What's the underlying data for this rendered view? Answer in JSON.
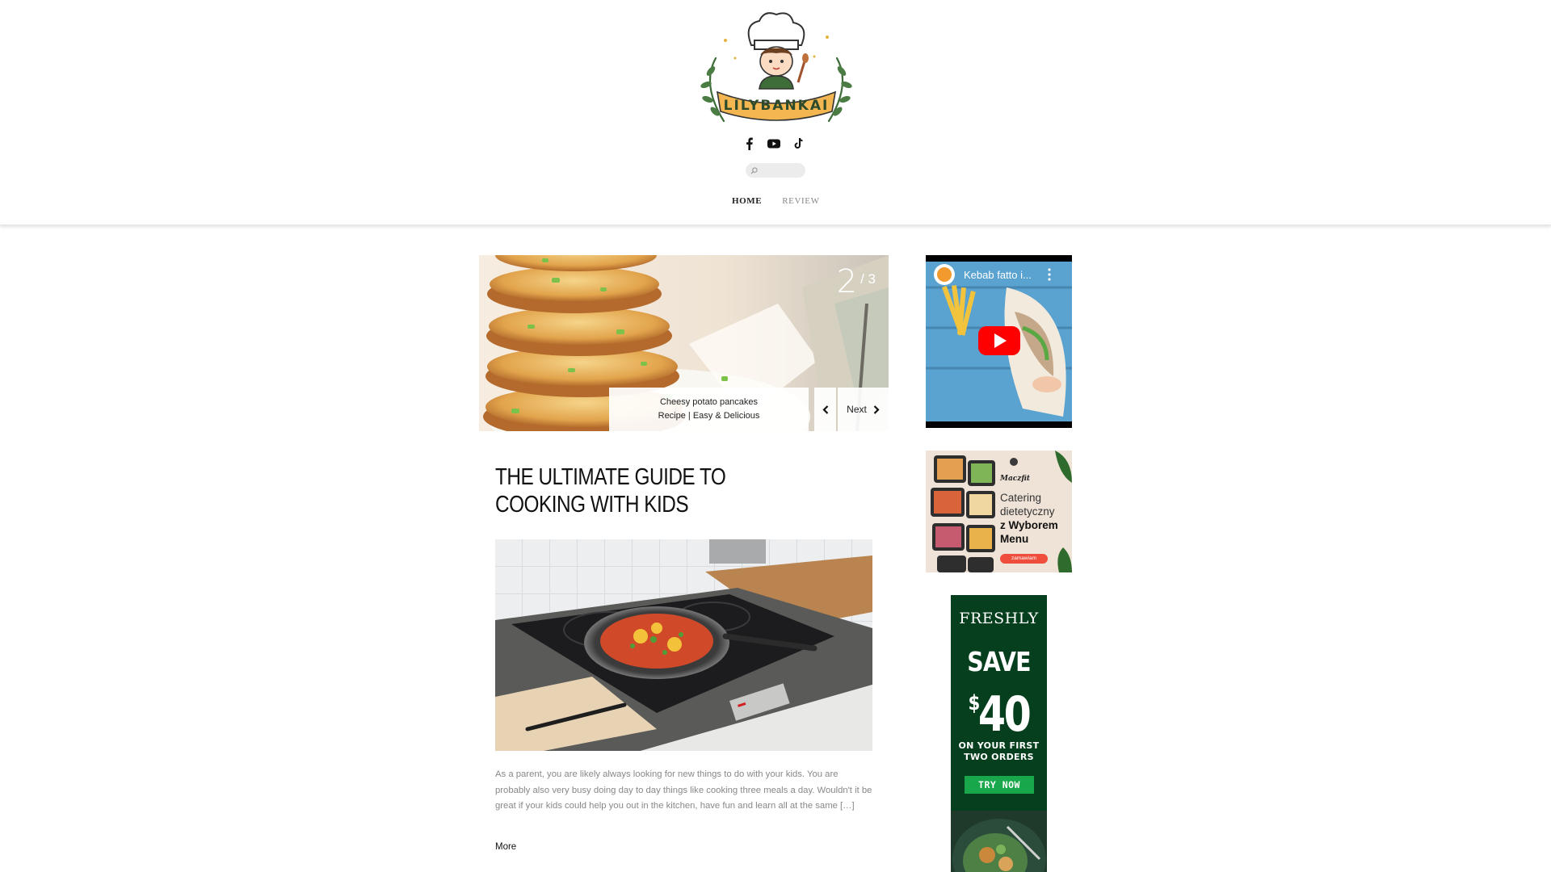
{
  "site": {
    "logo_text": "LILYBANKAI",
    "social_icons": [
      "facebook-icon",
      "youtube-icon",
      "tiktok-icon"
    ],
    "search_placeholder": "",
    "nav": [
      {
        "label": "HOME",
        "active": true
      },
      {
        "label": "REVIEW",
        "active": false
      }
    ]
  },
  "slider": {
    "current": "2",
    "total": "/ 3",
    "caption_line1": "Cheesy potato pancakes",
    "caption_line2": "Recipe | Easy & Delicious",
    "next_label": "Next"
  },
  "post": {
    "title": "THE ULTIMATE GUIDE TO COOKING WITH KIDS",
    "excerpt": "As a parent, you are likely always looking for new things to do with your kids. You are probably also very busy doing day to day things like cooking three meals a day. Wouldn't it be great if your kids could help you out in the kitchen, have fun and learn all at the same […]",
    "more_label": "More"
  },
  "sidebar": {
    "video_title": "Kebab fatto i...",
    "ad1": {
      "brand": "Maczfit",
      "line1": "Catering",
      "line2": "dietetyczny",
      "line3": "z Wyborem",
      "line4": "Menu",
      "button": "zamawiam"
    },
    "ad2": {
      "brand": "FRESHLY",
      "headline": "SAVE",
      "currency": "$",
      "amount": "40",
      "sub_line1": "ON YOUR FIRST",
      "sub_line2": "TWO ORDERS",
      "button": "TRY NOW"
    }
  },
  "colors": {
    "ad1_button": "#ee4e3b",
    "ad2_background": "#063f1d",
    "ad2_button": "#18a74a",
    "youtube_red": "#ff0000"
  }
}
